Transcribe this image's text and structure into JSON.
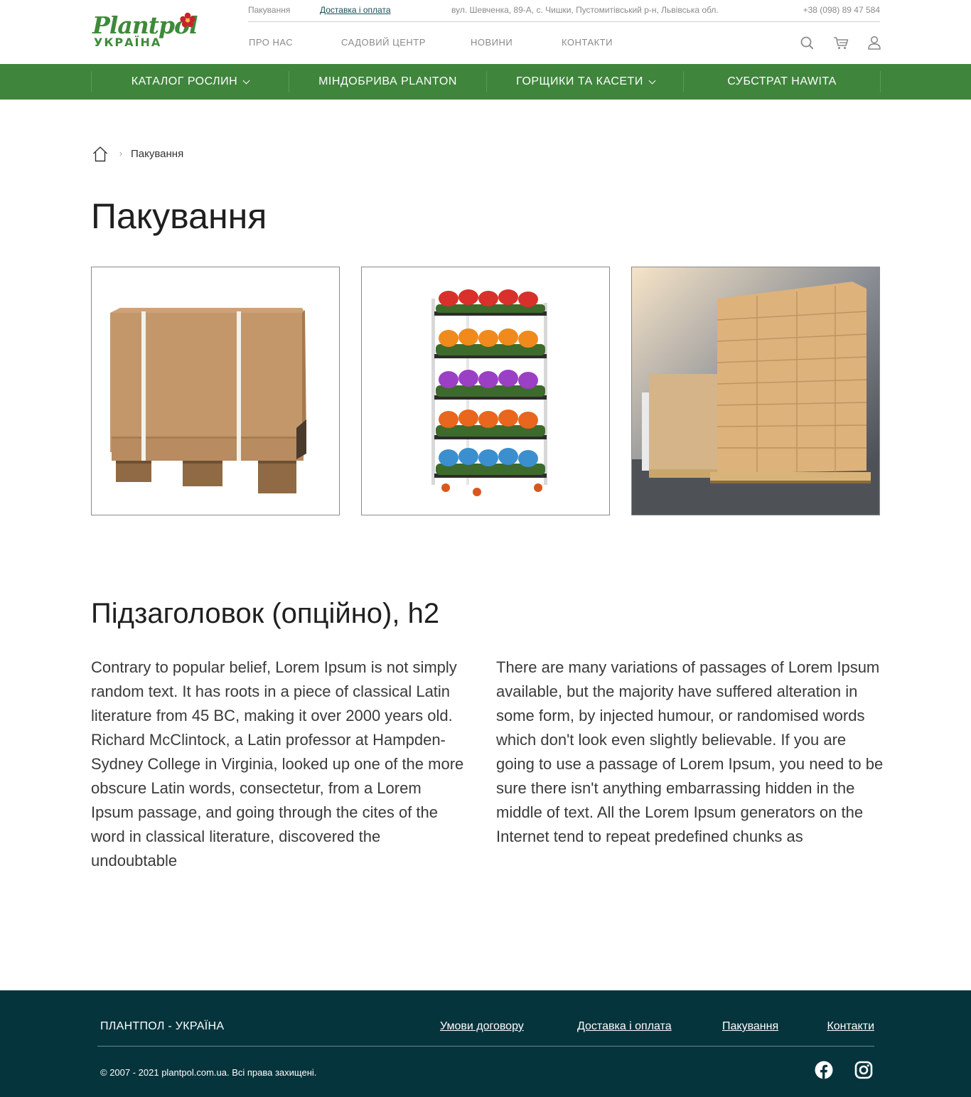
{
  "header": {
    "logo": {
      "top": "Plantpol",
      "bottom": "УКРАЇНА"
    },
    "topbar": {
      "packing": "Пакування",
      "delivery": "Доставка і оплата",
      "address": "вул. Шевченка, 89-А, с. Чишки, Пустомитівський р-н, Львівська обл.",
      "phone": "+38 (098) 89 47 584"
    },
    "nav": {
      "about": "ПРО НАС",
      "garden_center": "САДОВИЙ ЦЕНТР",
      "news": "НОВИНИ",
      "contacts": "КОНТАКТИ"
    },
    "icons": [
      "search-icon",
      "cart-icon",
      "user-icon"
    ]
  },
  "catalog_bar": {
    "items": [
      {
        "label": "КАТАЛОГ РОСЛИН",
        "has_dropdown": true
      },
      {
        "label": "МІНДОБРИВА PLANTON",
        "has_dropdown": false
      },
      {
        "label": "ГОРЩИКИ ТА КАСЕТИ",
        "has_dropdown": true
      },
      {
        "label": "СУБСТРАТ HAWITA",
        "has_dropdown": false
      }
    ]
  },
  "breadcrumb": {
    "current": "Пакування"
  },
  "page": {
    "title": "Пакування",
    "subtitle": "Підзаголовок (опційно), h2",
    "paragraph_left": "Contrary to popular belief, Lorem Ipsum is not simply random text. It has roots in a piece of classical Latin literature from 45 BC, making it over 2000 years old. Richard McClintock, a Latin professor at Hampden-Sydney College in Virginia, looked up one of the more obscure Latin words, consectetur, from a Lorem Ipsum passage, and going through the cites of the word in classical literature, discovered the undoubtable",
    "paragraph_right": "There are many variations of passages of Lorem Ipsum available, but the majority have suffered alteration in some form, by injected humour, or randomised words which don't look even slightly believable. If you are going to use a passage of Lorem Ipsum, you need to be sure there isn't anything embarrassing hidden in the middle of text. All the Lorem Ipsum generators on the Internet tend to repeat predefined chunks as"
  },
  "footer": {
    "brand": "ПЛАНТПОЛ - УКРАЇНА",
    "links": {
      "terms": "Умови договору",
      "delivery": "Доставка і оплата",
      "packing": "Пакування",
      "contacts": "Контакти"
    },
    "copyright": "© 2007 - 2021 plantpol.com.ua. Всі права захищені.",
    "social": [
      "facebook-icon",
      "instagram-icon"
    ]
  },
  "colors": {
    "brand_green": "#3f853c",
    "footer_bg": "#05343c",
    "link_teal": "#1a4d57"
  }
}
